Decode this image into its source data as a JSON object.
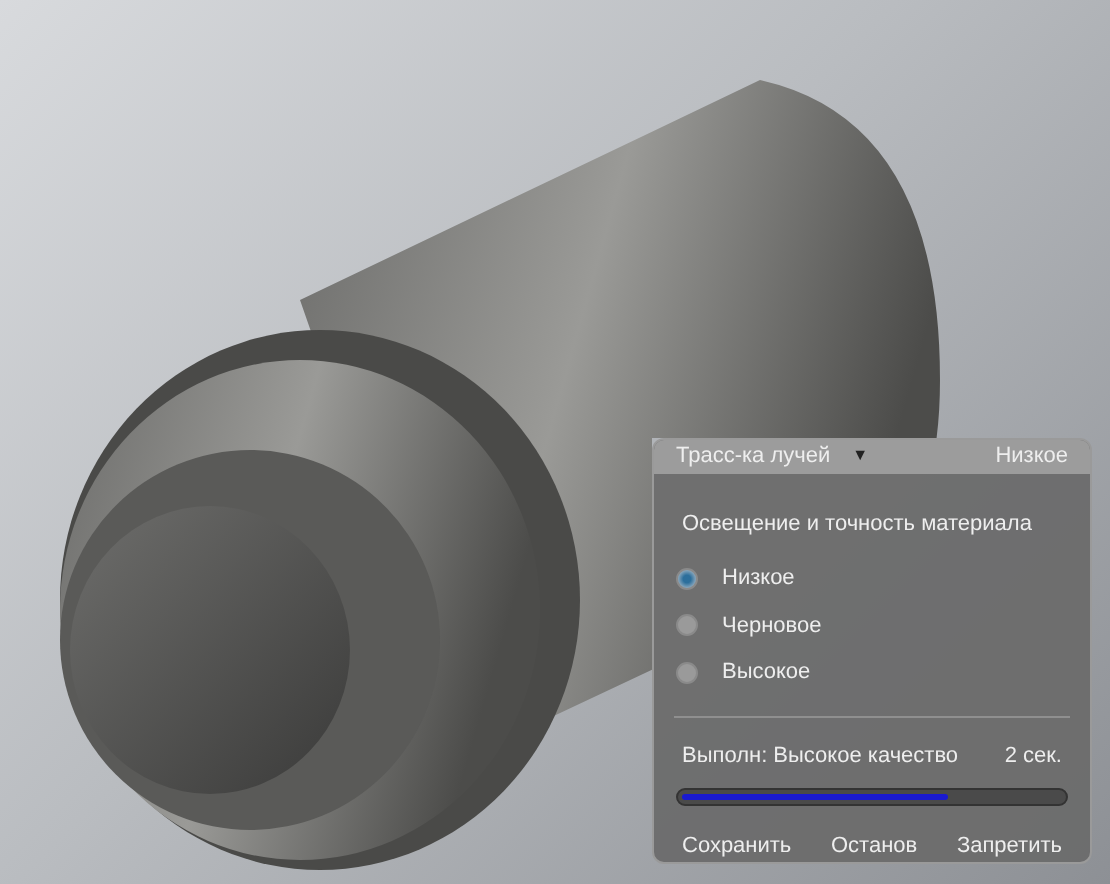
{
  "panel": {
    "title": "Трасс-ка лучей",
    "menu_glyph": "▼",
    "current_quality": "Низкое",
    "section_label": "Освещение и точность материала",
    "options": [
      {
        "label": "Низкое",
        "selected": true
      },
      {
        "label": "Черновое",
        "selected": false
      },
      {
        "label": "Высокое",
        "selected": false
      }
    ],
    "status": "Выполн: Высокое качество",
    "time": "2 сек.",
    "level": 0.7,
    "buttons": [
      "Сохранить",
      "Останов",
      "Запретить"
    ]
  }
}
